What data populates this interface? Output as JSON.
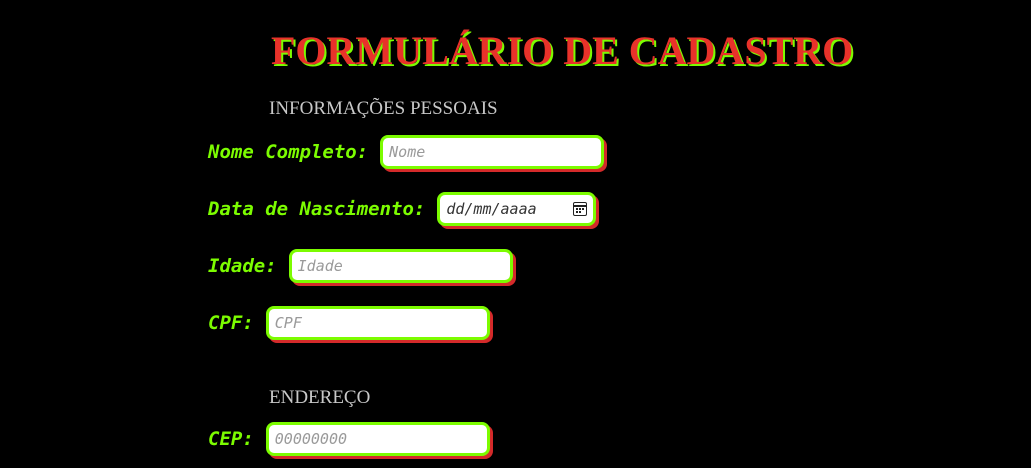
{
  "form": {
    "title": "FORMULÁRIO DE CADASTRO",
    "sections": {
      "personal": {
        "title": "INFORMAÇÕES PESSOAIS",
        "full_name": {
          "label": "Nome Completo:",
          "placeholder": "Nome",
          "value": ""
        },
        "birth_date": {
          "label": "Data de Nascimento:",
          "placeholder": "dd/mm/aaaa",
          "value": ""
        },
        "age": {
          "label": "Idade:",
          "placeholder": "Idade",
          "value": ""
        },
        "cpf": {
          "label": "CPF:",
          "placeholder": "CPF",
          "value": ""
        }
      },
      "address": {
        "title": "ENDEREÇO",
        "cep": {
          "label": "CEP:",
          "placeholder": "00000000",
          "value": ""
        }
      }
    }
  },
  "colors": {
    "background": "#000000",
    "title": "#e8322a",
    "title_shadow": "#7cfc00",
    "label": "#7cfc00",
    "field_border": "#7cfc00",
    "field_shadow": "#d42a2a",
    "section_title": "#c8c8c8"
  },
  "icons": {
    "date_picker": "calendar-icon"
  }
}
